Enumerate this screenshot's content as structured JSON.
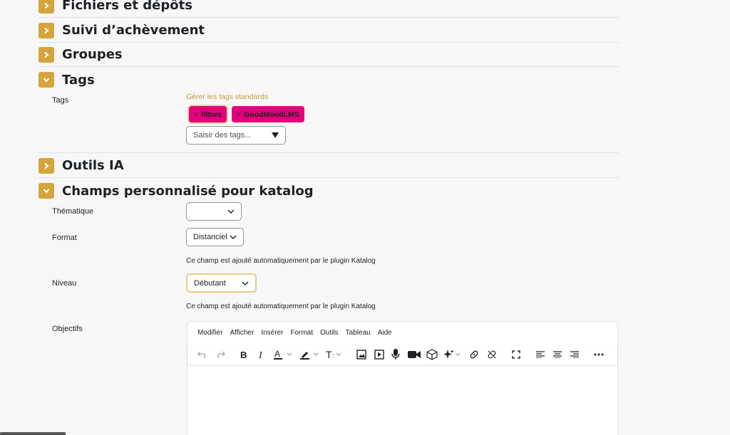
{
  "sections": {
    "fichiers": "Fichiers et dépôts",
    "suivi": "Suivi d’achèvement",
    "groupes": "Groupes",
    "tags": "Tags",
    "outils": "Outils IA",
    "champs": "Champs personnalisé pour katalog"
  },
  "tags_section": {
    "label": "Tags",
    "manage_link": "Gérer les tags standards",
    "tags": [
      "filtres",
      "GoodMoodLMS"
    ],
    "remove_symbol": "×",
    "input_placeholder": "Saisir des tags..."
  },
  "custom_fields": {
    "thematique_label": "Thématique",
    "thematique_value": "",
    "format_label": "Format",
    "format_value": "Distanciel",
    "format_hint": "Ce champ est ajouté automatiquement par le plugin Katalog",
    "niveau_label": "Niveau",
    "niveau_value": "Débutant",
    "niveau_hint": "Ce champ est ajouté automatiquement par le plugin Katalog",
    "objectifs_label": "Objectifs"
  },
  "editor": {
    "menu": [
      "Modifier",
      "Afficher",
      "Insérer",
      "Format",
      "Outils",
      "Tableau",
      "Aide"
    ]
  },
  "colors": {
    "accent": "#d4a53c",
    "tag_bg": "#e4007c",
    "link": "#c69a3c"
  }
}
